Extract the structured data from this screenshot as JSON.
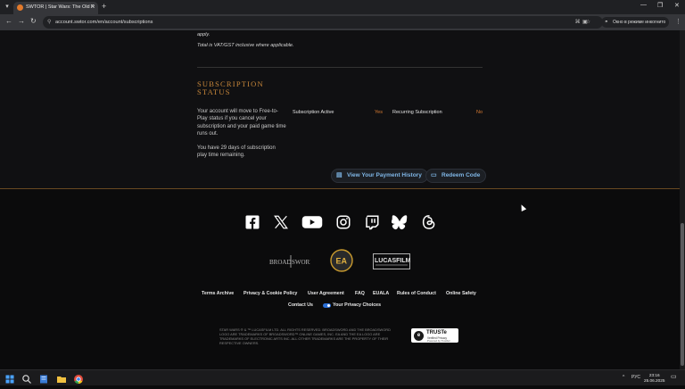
{
  "browser": {
    "tab_title": "SWTOR | Star Wars: The Old R",
    "url": "account.swtor.com/en/account/subscriptions",
    "incognito_label": "Окно в режиме инкогнито"
  },
  "billing": {
    "apply_text": "apply.",
    "vat_text": "Total is VAT/GST inclusive where applicable."
  },
  "subscription": {
    "title": "SUBSCRIPTION STATUS",
    "free_to_play_text": "Your account will move to Free-to-Play status if you cancel your subscription and your paid game time runs out.",
    "days_text": "You have 29 days of subscription play time remaining.",
    "active_label": "Subscription Active",
    "active_value": "Yes",
    "recurring_label": "Recurring Subscription",
    "recurring_value": "No",
    "payment_history_button": "View Your Payment History",
    "redeem_button": "Redeem Code"
  },
  "footer": {
    "social_icons": [
      "facebook-icon",
      "x-icon",
      "youtube-icon",
      "instagram-icon",
      "twitch-icon",
      "bluesky-icon",
      "threads-icon"
    ],
    "logos": {
      "broadsword": "BROADSWORD",
      "ea": "EA",
      "lucasfilm": "LUCASFILM"
    },
    "links": [
      "Terms Archive",
      "Privacy & Cookie Policy",
      "User Agreement",
      "FAQ",
      "EUALA",
      "Rules of Conduct",
      "Online Safety"
    ],
    "contact": "Contact Us",
    "privacy_choices": "Your Privacy Choices",
    "legal": "STAR WARS ® & ™ LUCASFILM LTD. ALL RIGHTS RESERVED. BROADSWORD AND THE BROADSWORD LOGO ARE TRADEMARKS OF BROADSWORD™ ONLINE GAMES, INC. EA AND THE EA LOGO ARE TRADEMARKS OF ELECTRONIC ARTS INC. ALL OTHER TRADEMARKS ARE THE PROPERTY OF THEIR RESPECTIVE OWNERS.",
    "truste": {
      "name": "TRUSTe",
      "line1": "Verified Privacy",
      "line2": "Powered by TrustArc"
    }
  },
  "taskbar": {
    "lang": "РУС",
    "time": "23:16",
    "date": "25.06.2025"
  },
  "colors": {
    "accent_gold": "#c8873a",
    "link_blue": "#7fb6e6",
    "value_orange": "#d87b32"
  }
}
